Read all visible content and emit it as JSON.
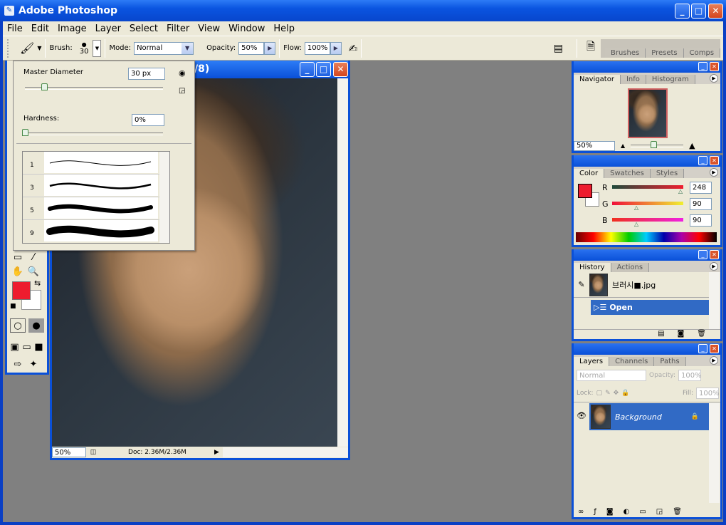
{
  "app": {
    "title": "Adobe Photoshop"
  },
  "menu": [
    "File",
    "Edit",
    "Image",
    "Layer",
    "Select",
    "Filter",
    "View",
    "Window",
    "Help"
  ],
  "options": {
    "brush_label": "Brush:",
    "brush_size": "30",
    "mode_label": "Mode:",
    "mode_value": "Normal",
    "opacity_label": "Opacity:",
    "opacity_value": "50%",
    "flow_label": "Flow:",
    "flow_value": "100%"
  },
  "palette_well": {
    "tabs": [
      "Brushes",
      "Presets",
      "Comps"
    ]
  },
  "brush_popup": {
    "master_diameter_label": "Master Diameter",
    "master_diameter_value": "30 px",
    "master_diameter_level": 0.15,
    "hardness_label": "Hardness:",
    "hardness_value": "0%",
    "hardness_level": 0,
    "presets": [
      "1",
      "3",
      "5",
      "9"
    ]
  },
  "document": {
    "title_visible": "/8)",
    "zoom": "50%",
    "doc_info": "Doc: 2.36M/2.36M"
  },
  "navigator": {
    "tabs": [
      "Navigator",
      "Info",
      "Histogram"
    ],
    "zoom": "50%"
  },
  "color": {
    "tabs": [
      "Color",
      "Swatches",
      "Styles"
    ],
    "foreground": "#f8205a",
    "r_label": "R",
    "g_label": "G",
    "b_label": "B",
    "r": "248",
    "g": "90",
    "b": "90"
  },
  "history": {
    "tabs": [
      "History",
      "Actions"
    ],
    "snapshot": "브러시■.jpg",
    "items": [
      "Open"
    ]
  },
  "layers": {
    "tabs": [
      "Layers",
      "Channels",
      "Paths"
    ],
    "blend": "Normal",
    "opacity_label": "Opacity:",
    "opacity": "100%",
    "lock_label": "Lock:",
    "fill_label": "Fill:",
    "fill": "100%",
    "layer_name": "Background"
  },
  "colors": {
    "accent": "#316ac5",
    "titlebar": "#0a50d8",
    "foreground": "#ed1c2e",
    "background": "#ffffff"
  }
}
